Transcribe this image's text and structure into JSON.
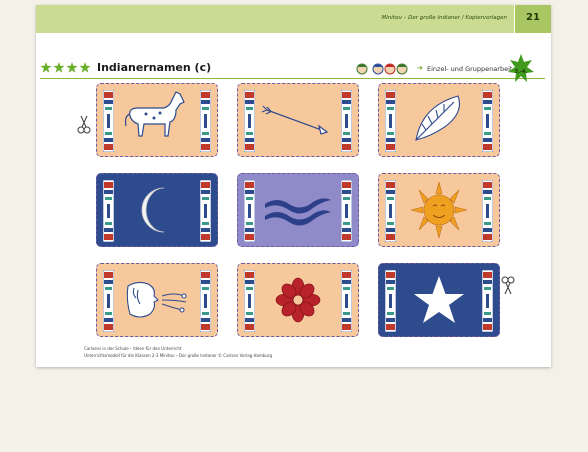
{
  "header": {
    "running_head": "Minitou – Der große Indianer / Kopiervorlagen",
    "page_number": "21"
  },
  "title_block": {
    "stars_icon": "four-green-stars",
    "title": "Indianernamen (c)",
    "kids_icon": "children-group-icon",
    "work_mode": "Einzel- und Gruppenarbeit",
    "level_badge": "3.-4."
  },
  "cards": [
    {
      "motif": "horse-icon",
      "style": "tan"
    },
    {
      "motif": "arrow-icon",
      "style": "tan"
    },
    {
      "motif": "feather-icon",
      "style": "tan"
    },
    {
      "motif": "moon-icon",
      "style": "navy"
    },
    {
      "motif": "water-waves-icon",
      "style": "lavender"
    },
    {
      "motif": "sun-icon",
      "style": "tan"
    },
    {
      "motif": "wind-icon",
      "style": "tan"
    },
    {
      "motif": "flower-icon",
      "style": "tan"
    },
    {
      "motif": "star-icon",
      "style": "navy"
    }
  ],
  "footer": {
    "line1": "Carlsens in der Schule – Ideen für den Unterricht",
    "line2": "Unterrichtsmodell für die Klassen 2-3 Minitou – Der große Indianer © Carlsen Verlag Hamburg"
  },
  "colors": {
    "header_green": "#c9dc92",
    "card_tan": "#f6c89c",
    "card_navy": "#2e4b8e",
    "card_lavender": "#8f8ac8"
  }
}
